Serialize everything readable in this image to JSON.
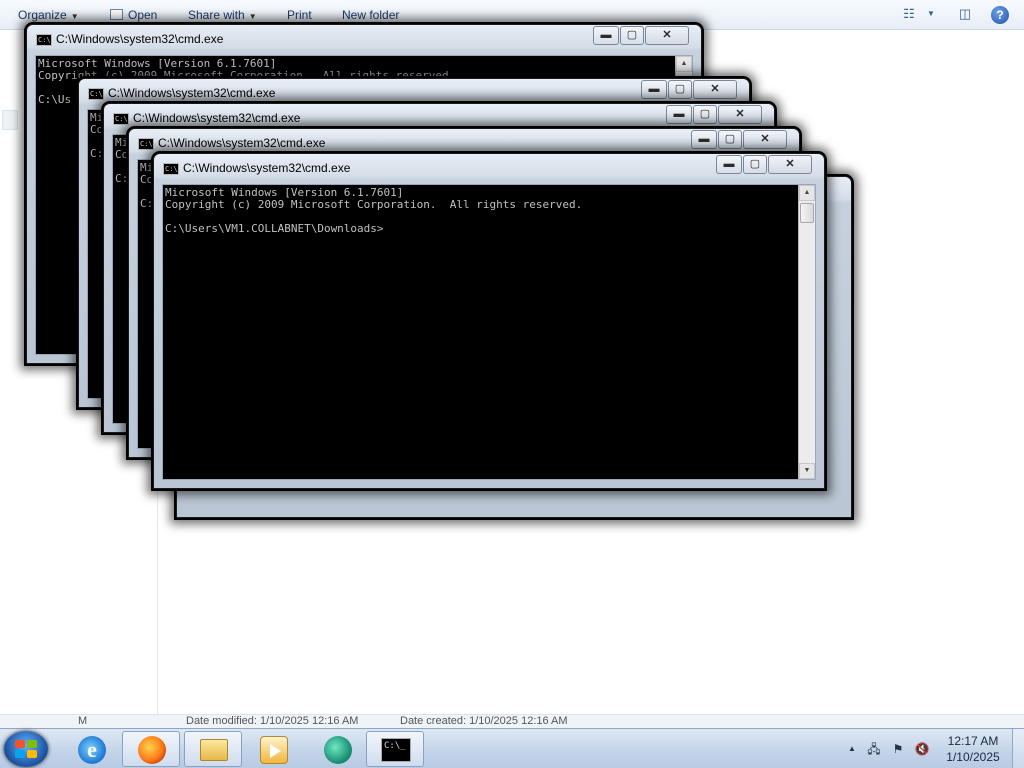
{
  "explorer": {
    "toolbar": {
      "organize": "Organize",
      "open": "Open",
      "share_with": "Share with",
      "print": "Print",
      "new_folder": "New folder"
    },
    "details_bar": {
      "name_fragment": "M",
      "date_modified": "Date modified: 1/10/2025 12:16 AM",
      "date_created": "Date created: 1/10/2025 12:16 AM"
    }
  },
  "cmd_windows": [
    {
      "title": "C:\\Windows\\system32\\cmd.exe",
      "lines": [
        "Microsoft Windows [Version 6.1.7601]",
        "Copyright (c) 2009 Microsoft Corporation.  All rights reserved.",
        "",
        "C:\\Us"
      ]
    },
    {
      "title": "C:\\Windows\\system32\\cmd.exe",
      "lines": [
        "Mi",
        "Co",
        "",
        "C:"
      ]
    },
    {
      "title": "C:\\Windows\\system32\\cmd.exe",
      "lines": [
        "Mi",
        "Co",
        "",
        "C:"
      ]
    },
    {
      "title": "C:\\Windows\\system32\\cmd.exe",
      "lines": [
        "Mi",
        "Co",
        "",
        "C:"
      ]
    },
    {
      "title": "C:\\Windows\\system32\\cmd.exe",
      "lines": [
        "Microsoft Windows [Version 6.1.7601]",
        "Copyright (c) 2009 Microsoft Corporation.  All rights reserved.",
        "",
        "C:\\Users\\VM1.COLLABNET\\Downloads>"
      ]
    }
  ],
  "window_buttons": {
    "minimize": "▬",
    "maximize": "▢",
    "close": "✕"
  },
  "taskbar": {
    "apps": [
      "internet-explorer",
      "firefox",
      "windows-explorer",
      "media-player",
      "vm-tool",
      "command-prompt"
    ],
    "cmd_icon_text": "C:\\_",
    "tray": {
      "up_arrow": "▲",
      "network": "network-icon",
      "flag": "action-center-icon",
      "volume": "volume-muted-icon"
    },
    "time": "12:17 AM",
    "date": "1/10/2025"
  }
}
